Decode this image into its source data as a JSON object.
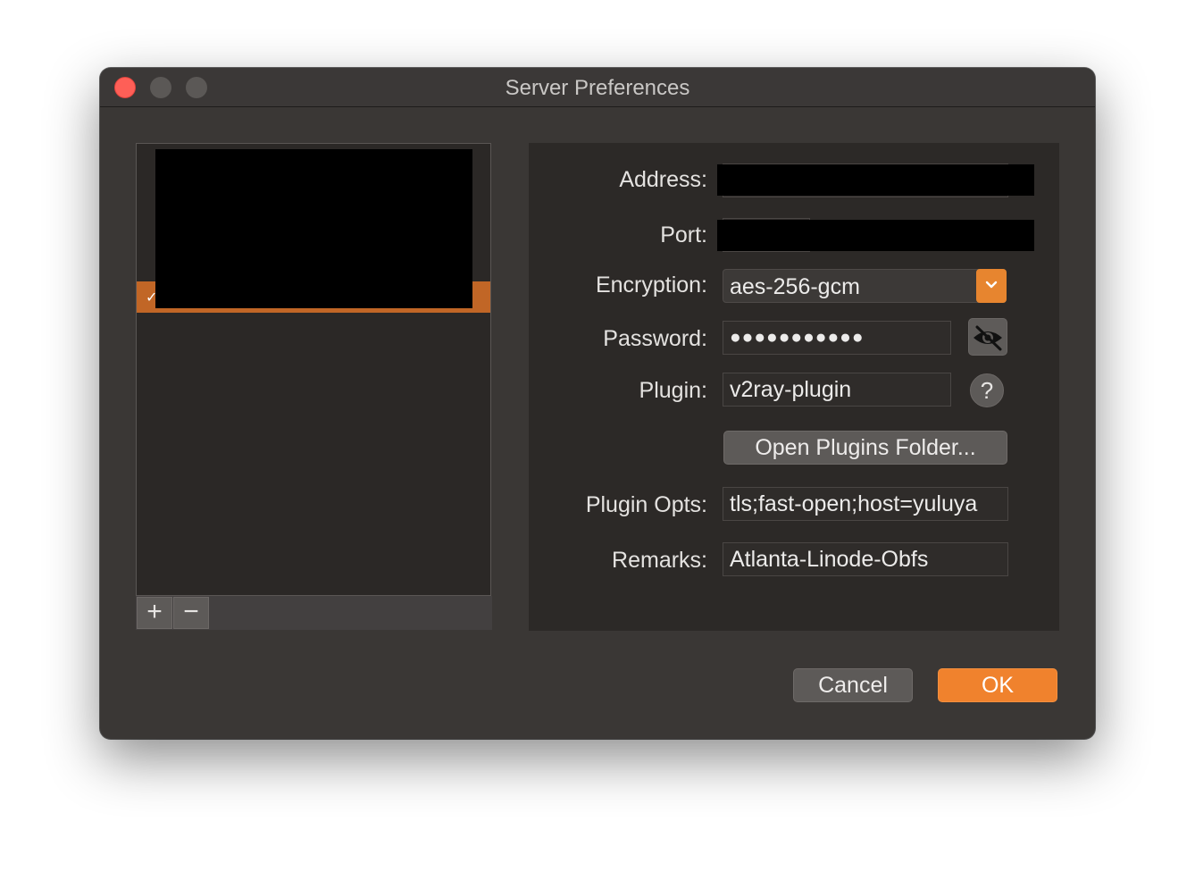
{
  "window": {
    "title": "Server Preferences"
  },
  "server_list": {
    "add_label": "+",
    "remove_label": "−",
    "selected_mark": "✓"
  },
  "form": {
    "address": {
      "label": "Address:"
    },
    "port": {
      "label": "Port:"
    },
    "encryption": {
      "label": "Encryption:",
      "value": "aes-256-gcm"
    },
    "password": {
      "label": "Password:",
      "value": "●●●●●●●●●●●"
    },
    "plugin": {
      "label": "Plugin:",
      "value": "v2ray-plugin",
      "help": "?"
    },
    "open_plugins_folder": "Open Plugins Folder...",
    "plugin_opts": {
      "label": "Plugin Opts:",
      "value": "tls;fast-open;host=yuluya"
    },
    "remarks": {
      "label": "Remarks:",
      "value": "Atlanta-Linode-Obfs"
    }
  },
  "buttons": {
    "cancel": "Cancel",
    "ok": "OK"
  },
  "colors": {
    "accent": "#f0822d",
    "selection": "#c16626",
    "close": "#fe5f57"
  }
}
